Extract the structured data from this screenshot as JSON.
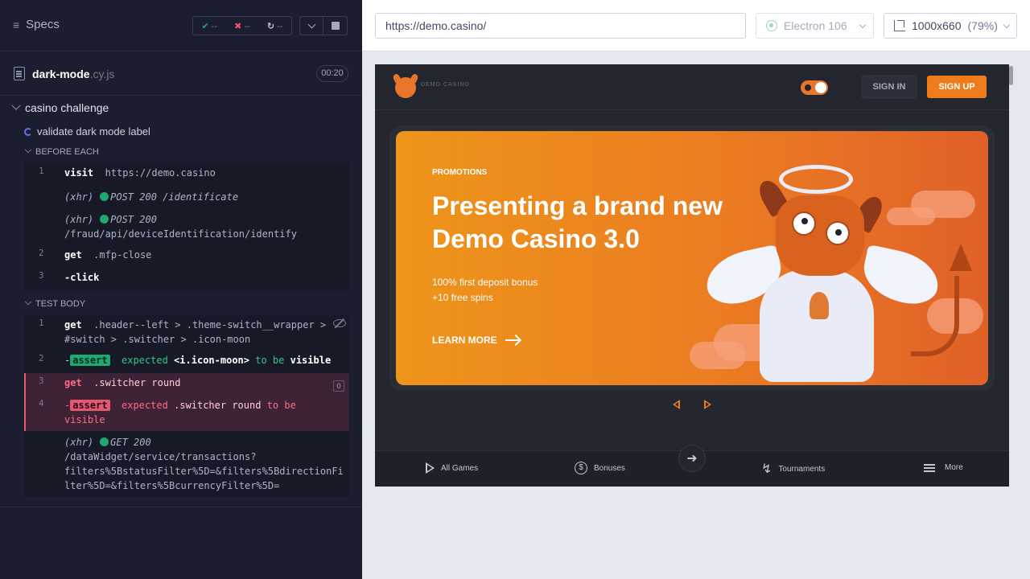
{
  "reporter": {
    "specs_label": "Specs",
    "stats": {
      "passed": "--",
      "failed": "--",
      "pending": "--"
    },
    "spec_file": {
      "name": "dark-mode",
      "ext": ".cy.js",
      "duration": "00:20"
    },
    "suite_title": "casino challenge",
    "test_title": "validate dark mode label",
    "before_each": {
      "title": "BEFORE EACH",
      "commands": [
        {
          "num": "1",
          "name": "visit",
          "arg": "https://demo.casino"
        },
        {
          "num": "",
          "xhr": "(xhr)",
          "method": "POST 200 /identificate"
        },
        {
          "num": "",
          "xhr": "(xhr)",
          "method": "POST 200",
          "cont": "/fraud/api/deviceIdentification/identify"
        },
        {
          "num": "2",
          "name": "get",
          "arg": ".mfp-close"
        },
        {
          "num": "3",
          "name": "-click",
          "arg": ""
        }
      ]
    },
    "test_body": {
      "title": "TEST BODY",
      "commands": [
        {
          "num": "1",
          "name": "get",
          "arg": ".header--left > .theme-switch__wrapper >",
          "cont": "#switch > .switcher > .icon-moon"
        },
        {
          "num": "2",
          "prefix": "-",
          "tag": "assert",
          "expected": "expected",
          "subject": "<i.icon-moon>",
          "tobe": "to be",
          "state": "visible"
        },
        {
          "num": "3",
          "name": "get",
          "arg": ".switcher round",
          "badge": "0"
        },
        {
          "num": "4",
          "prefix": "-",
          "tag": "assert",
          "expected": "expected",
          "subject": ".switcher round",
          "tobe": "to be",
          "state": "visible"
        },
        {
          "num": "",
          "xhr": "(xhr)",
          "method": "GET 200",
          "cont": "/dataWidget/service/transactions?",
          "cont2": "filters%5BstatusFilter%5D=&filters%5BdirectionFi",
          "cont3": "lter%5D=&filters%5BcurrencyFilter%5D="
        }
      ]
    }
  },
  "aut_header": {
    "url": "https://demo.casino/",
    "browser": "Electron 106",
    "viewport": "1000x660",
    "scale": "(79%)"
  },
  "site": {
    "logo_text": "DEMO CASINO",
    "signin": "SIGN IN",
    "signup": "SIGN UP",
    "hero": {
      "tag": "PROMOTIONS",
      "title": "Presenting a brand new Demo Casino 3.0",
      "line1": "100% first deposit bonus",
      "line2": "+10 free spins",
      "cta": "LEARN MORE"
    },
    "nav": {
      "all_games": "All Games",
      "bonuses": "Bonuses",
      "tournaments": "Tournaments",
      "more": "More"
    }
  },
  "colors": {
    "accent": "#ee7c1d",
    "pass": "#1fa971",
    "fail": "#e45770",
    "panel": "#1b1e2e"
  },
  "icons": [
    "specs-list-icon",
    "check-icon",
    "x-icon",
    "spinner-icon",
    "chevron-down-icon",
    "stop-icon",
    "file-icon",
    "eye-slash-icon",
    "electron-icon",
    "ruler-icon",
    "arrow-right-icon",
    "play-icon",
    "coin-icon",
    "login-icon",
    "bolt-icon",
    "menu-icon"
  ]
}
